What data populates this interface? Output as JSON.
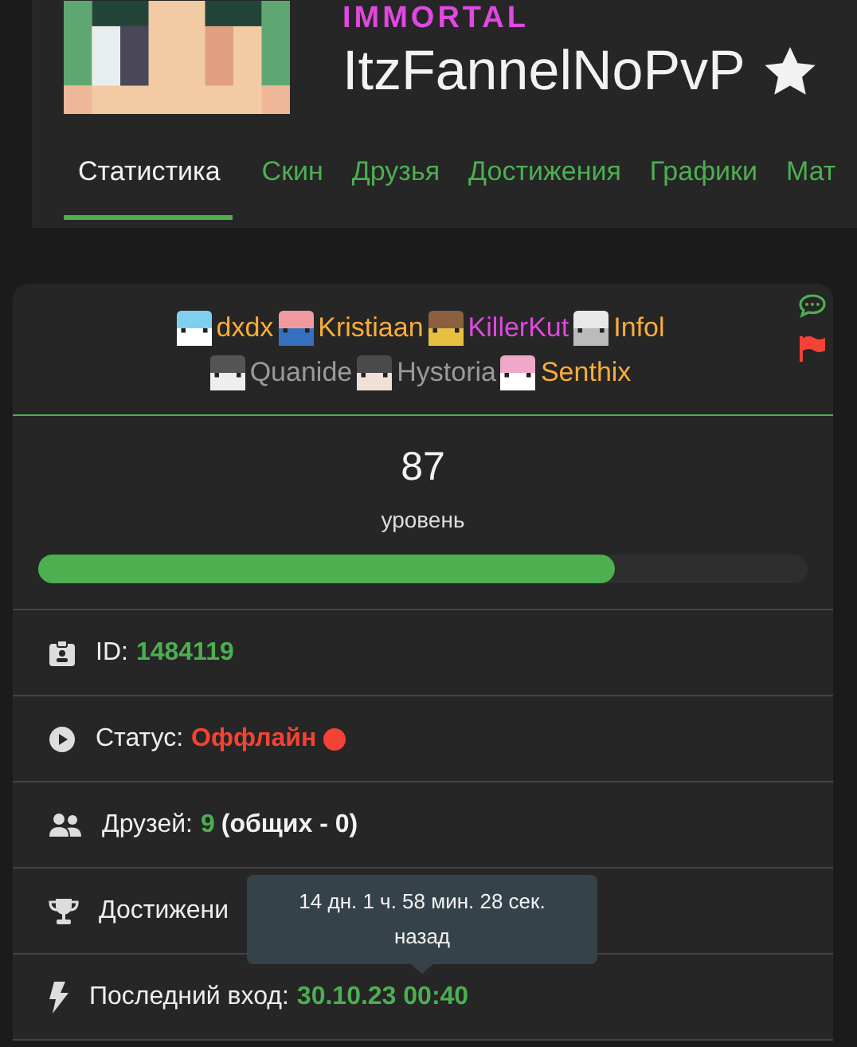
{
  "profile": {
    "rank": "IMMORTAL",
    "name": "ItzFannelNoPvP"
  },
  "tabs": [
    {
      "label": "Статистика",
      "selected": true
    },
    {
      "label": "Скин",
      "selected": false
    },
    {
      "label": "Друзья",
      "selected": false
    },
    {
      "label": "Достижения",
      "selected": false
    },
    {
      "label": "Графики",
      "selected": false
    },
    {
      "label": "Мат",
      "selected": false
    }
  ],
  "friends": [
    {
      "name": "dxdx",
      "color": "#f9ad3b"
    },
    {
      "name": "Kristiaan",
      "color": "#f9ad3b"
    },
    {
      "name": "KillerKut",
      "color": "#e048e0"
    },
    {
      "name": "Infol",
      "color": "#f9ad3b"
    },
    {
      "name": "Quanide",
      "color": "#9a9a9a"
    },
    {
      "name": "Hystoria",
      "color": "#9a9a9a"
    },
    {
      "name": "Senthix",
      "color": "#f9ad3b"
    }
  ],
  "level": {
    "value": "87",
    "caption": "уровень",
    "level": 0.75
  },
  "rows": [
    {
      "kind": "id",
      "label": "ID:",
      "value": "1484119"
    },
    {
      "kind": "status",
      "label": "Статус:",
      "value": "Оффлайн",
      "online": false
    },
    {
      "kind": "friends",
      "label": "Друзей:",
      "value": "9",
      "extra": "(общих - 0)"
    },
    {
      "kind": "achievements",
      "label": "Достижени"
    },
    {
      "kind": "last_login",
      "label": "Последний вход:",
      "value": "30.10.23 00:40"
    }
  ],
  "tooltip": {
    "text": "14 дн. 1 ч. 58 мин. 28 сек. назад"
  }
}
